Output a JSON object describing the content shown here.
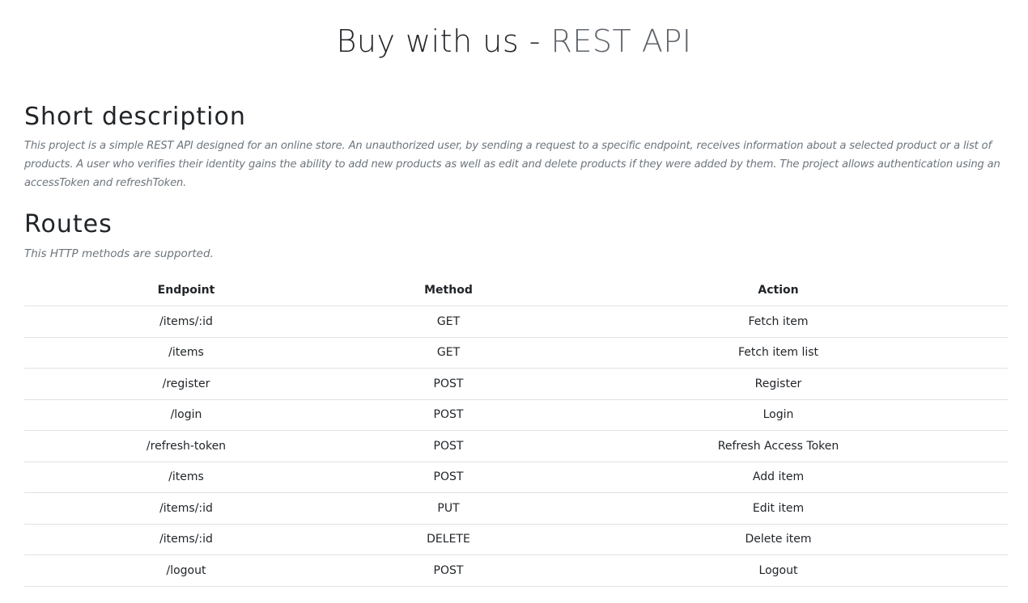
{
  "header": {
    "title_main": "Buy with us -",
    "title_accent": "REST API"
  },
  "description": {
    "heading": "Short description",
    "text": "This project is a simple REST API designed for an online store. An unauthorized user, by sending a request to a specific endpoint, receives information about a selected product or a list of products. A user who verifies their identity gains the ability to add new products as well as edit and delete products if they were added by them. The project allows authentication using an accessToken and refreshToken."
  },
  "routes": {
    "heading": "Routes",
    "text": "This HTTP methods are supported.",
    "columns": {
      "endpoint": "Endpoint",
      "method": "Method",
      "action": "Action"
    },
    "rows": [
      {
        "endpoint": "/items/:id",
        "method": "GET",
        "action": "Fetch item"
      },
      {
        "endpoint": "/items",
        "method": "GET",
        "action": "Fetch item list"
      },
      {
        "endpoint": "/register",
        "method": "POST",
        "action": "Register"
      },
      {
        "endpoint": "/login",
        "method": "POST",
        "action": "Login"
      },
      {
        "endpoint": "/refresh-token",
        "method": "POST",
        "action": "Refresh Access Token"
      },
      {
        "endpoint": "/items",
        "method": "POST",
        "action": "Add item"
      },
      {
        "endpoint": "/items/:id",
        "method": "PUT",
        "action": "Edit item"
      },
      {
        "endpoint": "/items/:id",
        "method": "DELETE",
        "action": "Delete item"
      },
      {
        "endpoint": "/logout",
        "method": "POST",
        "action": "Logout"
      }
    ]
  }
}
